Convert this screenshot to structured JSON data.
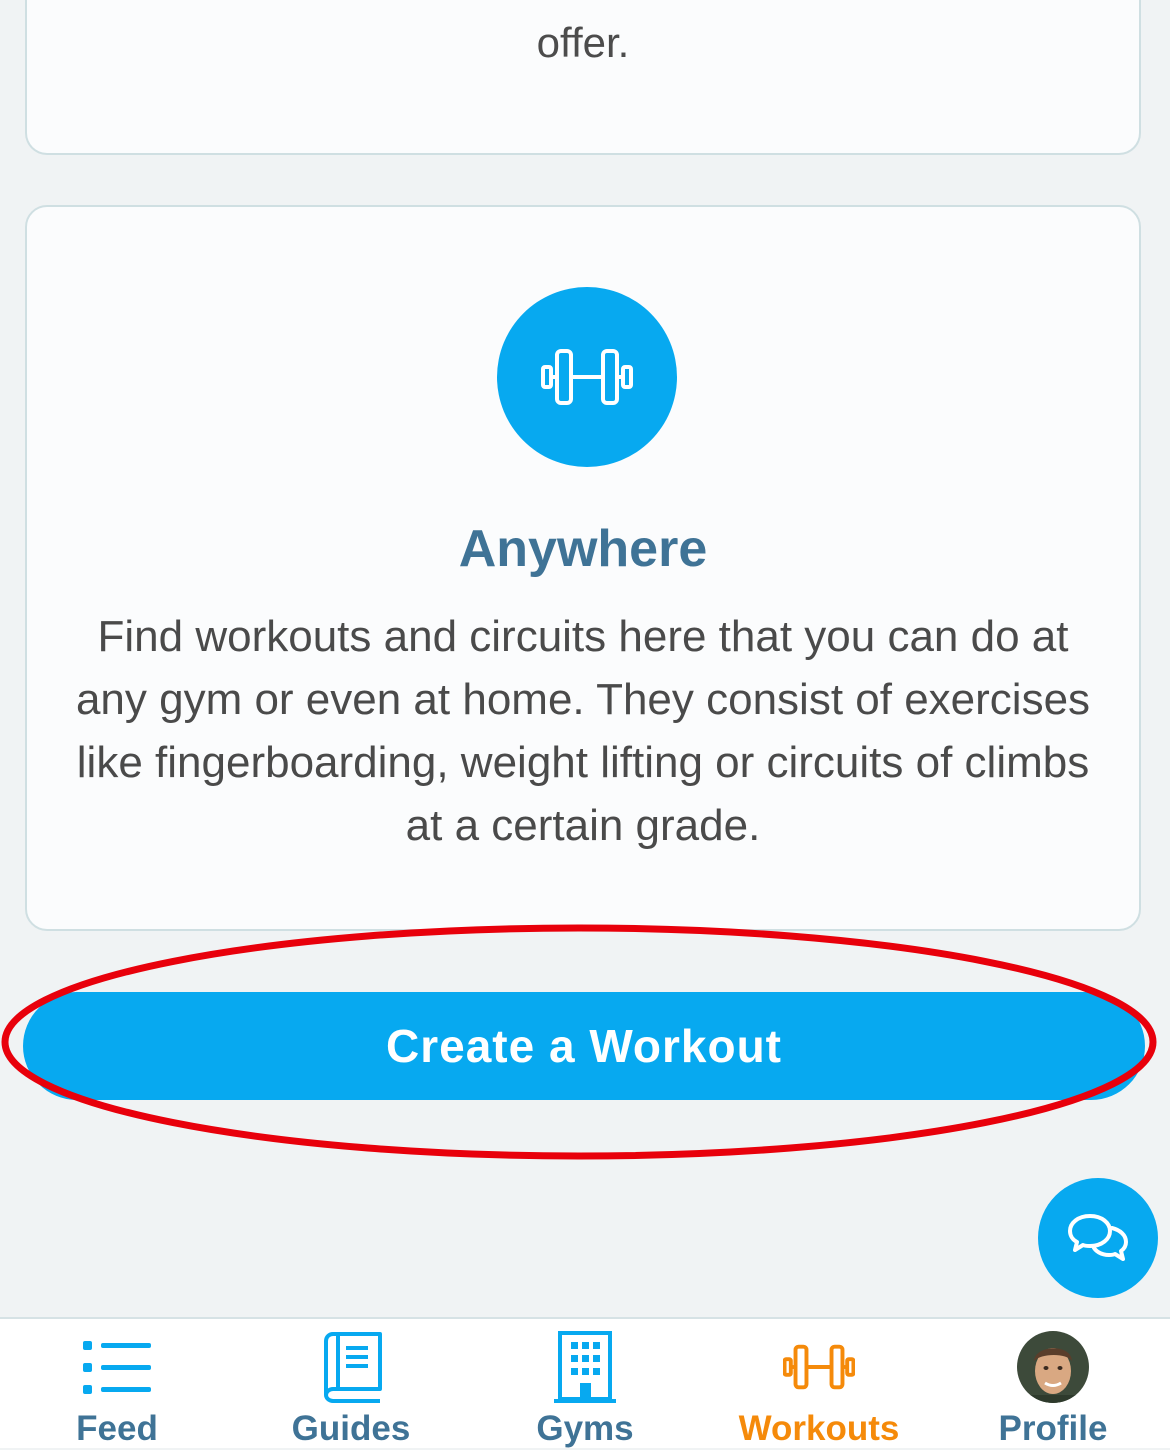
{
  "previous_card": {
    "text_tail": "offer."
  },
  "anywhere_card": {
    "icon": "dumbbell-icon",
    "title": "Anywhere",
    "description": "Find workouts and circuits here that you can do at any gym or even at home. They consist of exercises like fingerboarding, weight lifting or circuits of climbs at a certain grade."
  },
  "create_button": {
    "label": "Create a Workout"
  },
  "chat_button": {
    "icon": "chat-bubbles-icon"
  },
  "tabs": [
    {
      "label": "Feed",
      "icon": "list-icon",
      "active": false
    },
    {
      "label": "Guides",
      "icon": "book-icon",
      "active": false
    },
    {
      "label": "Gyms",
      "icon": "building-icon",
      "active": false
    },
    {
      "label": "Workouts",
      "icon": "dumbbell-icon",
      "active": true
    },
    {
      "label": "Profile",
      "icon": "avatar",
      "active": false
    }
  ],
  "colors": {
    "accent": "#07a9f0",
    "active_tab": "#f58a0a",
    "heading": "#3f7396",
    "background": "#f0f3f4",
    "highlight": "#e8000b"
  }
}
